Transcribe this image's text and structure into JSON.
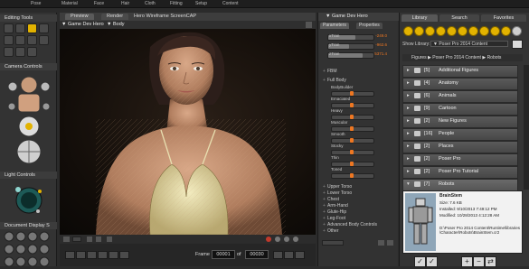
{
  "menubar": {
    "items": [
      "Pose",
      "Material",
      "Face",
      "Hair",
      "Cloth",
      "Fitting",
      "Setup",
      "Content"
    ]
  },
  "left_panel": {
    "editing_tools_title": "Editing Tools",
    "camera_controls_title": "Camera Controls",
    "light_controls_title": "Light Controls",
    "document_display_title": "Document Display S"
  },
  "viewport": {
    "tabs": [
      "Preview",
      "Render"
    ],
    "scene_title": "Hero Wireframe ScreenCAP",
    "camera_select": "Game Dev Hero",
    "body_select": "Body",
    "frame_label": "Frame",
    "frame_value": "00001",
    "of_label": "of",
    "frame_total": "00030"
  },
  "params": {
    "title": "Game Dev Hero",
    "tabs": [
      "Parameters",
      "Properties"
    ],
    "transforms": [
      {
        "label": "xTran",
        "value": "-249.0"
      },
      {
        "label": "yTran",
        "value": "-962.6"
      },
      {
        "label": "zTran",
        "value": "5371.4"
      }
    ],
    "fbm_label": "FBM",
    "fullbody_label": "Full Body",
    "morphs": [
      "BodyBuilder",
      "Emaciated",
      "Heavy",
      "Muscular",
      "Smooth",
      "Stocky",
      "Thin",
      "Toned"
    ],
    "groups": [
      "Upper Torso",
      "Lower Torso",
      "Chest",
      "Arm-Hand",
      "Glute-Hip",
      "Leg-Foot",
      "Advanced Body Controls",
      "Other"
    ]
  },
  "library": {
    "tabs": [
      "Library",
      "Search",
      "Favorites"
    ],
    "show_label": "Show Library:",
    "show_value": "Poser Pro 2014 Content",
    "breadcrumb": "Figures ▶ Poser Pro 2014 Content ▶ Robots",
    "items": [
      {
        "count": "[5]",
        "name": "Additional Figures"
      },
      {
        "count": "[4]",
        "name": "Anatomy"
      },
      {
        "count": "[6]",
        "name": "Animals"
      },
      {
        "count": "[9]",
        "name": "Cartoon"
      },
      {
        "count": "[2]",
        "name": "New Figures"
      },
      {
        "count": "[16]",
        "name": "People"
      },
      {
        "count": "[2]",
        "name": "Places"
      },
      {
        "count": "[2]",
        "name": "Poser Pro"
      },
      {
        "count": "[2]",
        "name": "Poser Pro Tutorial"
      },
      {
        "count": "[7]",
        "name": "Robots"
      }
    ],
    "selected_index": 9,
    "preview": {
      "name": "BrainStem",
      "size": "Size: 7.6 KB",
      "installed": "Installed: 9/10/2013 7:49:12 PM",
      "modified": "Modified: 10/28/2013 4:12:28 AM",
      "path": "D:\\Poser Pro 2014 Content\\Runtime\\libraries\\Character\\Robots\\BrainStem.cr2"
    }
  },
  "colors": {
    "accent": "#e2b200",
    "value_orange": "#ee7722"
  }
}
